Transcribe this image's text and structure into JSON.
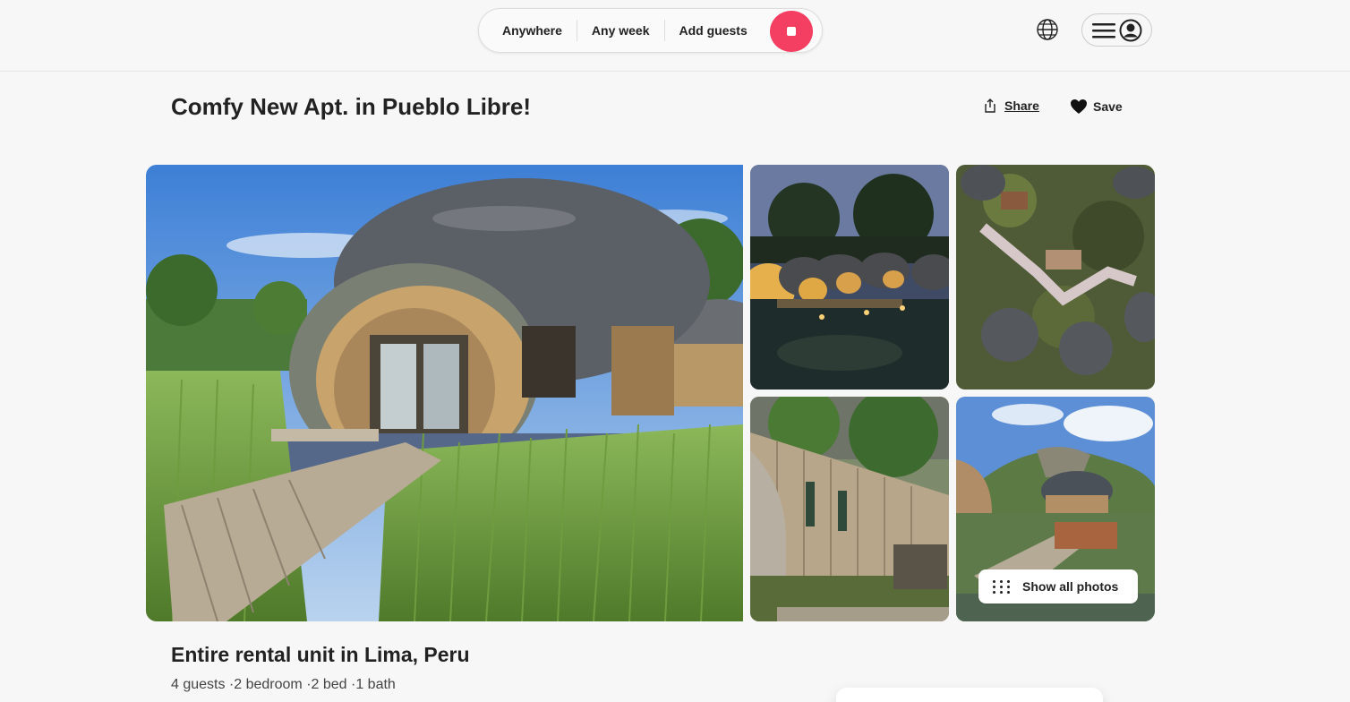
{
  "header": {
    "search": {
      "where": "Anywhere",
      "when": "Any week",
      "who": "Add guests"
    },
    "icons": {
      "globe": "globe-icon",
      "menu": "hamburger-menu-icon",
      "user": "user-avatar-icon",
      "search": "search-icon"
    },
    "accent_color": "#f43f62"
  },
  "listing": {
    "title": "Comfy New Apt. in Pueblo Libre!",
    "share_label": "Share",
    "save_label": "Save",
    "show_all_photos_label": "Show all photos",
    "subtitle": "Entire rental unit in Lima, Peru",
    "details": "4 guests ·2 bedroom ·2 bed ·1 bath"
  }
}
